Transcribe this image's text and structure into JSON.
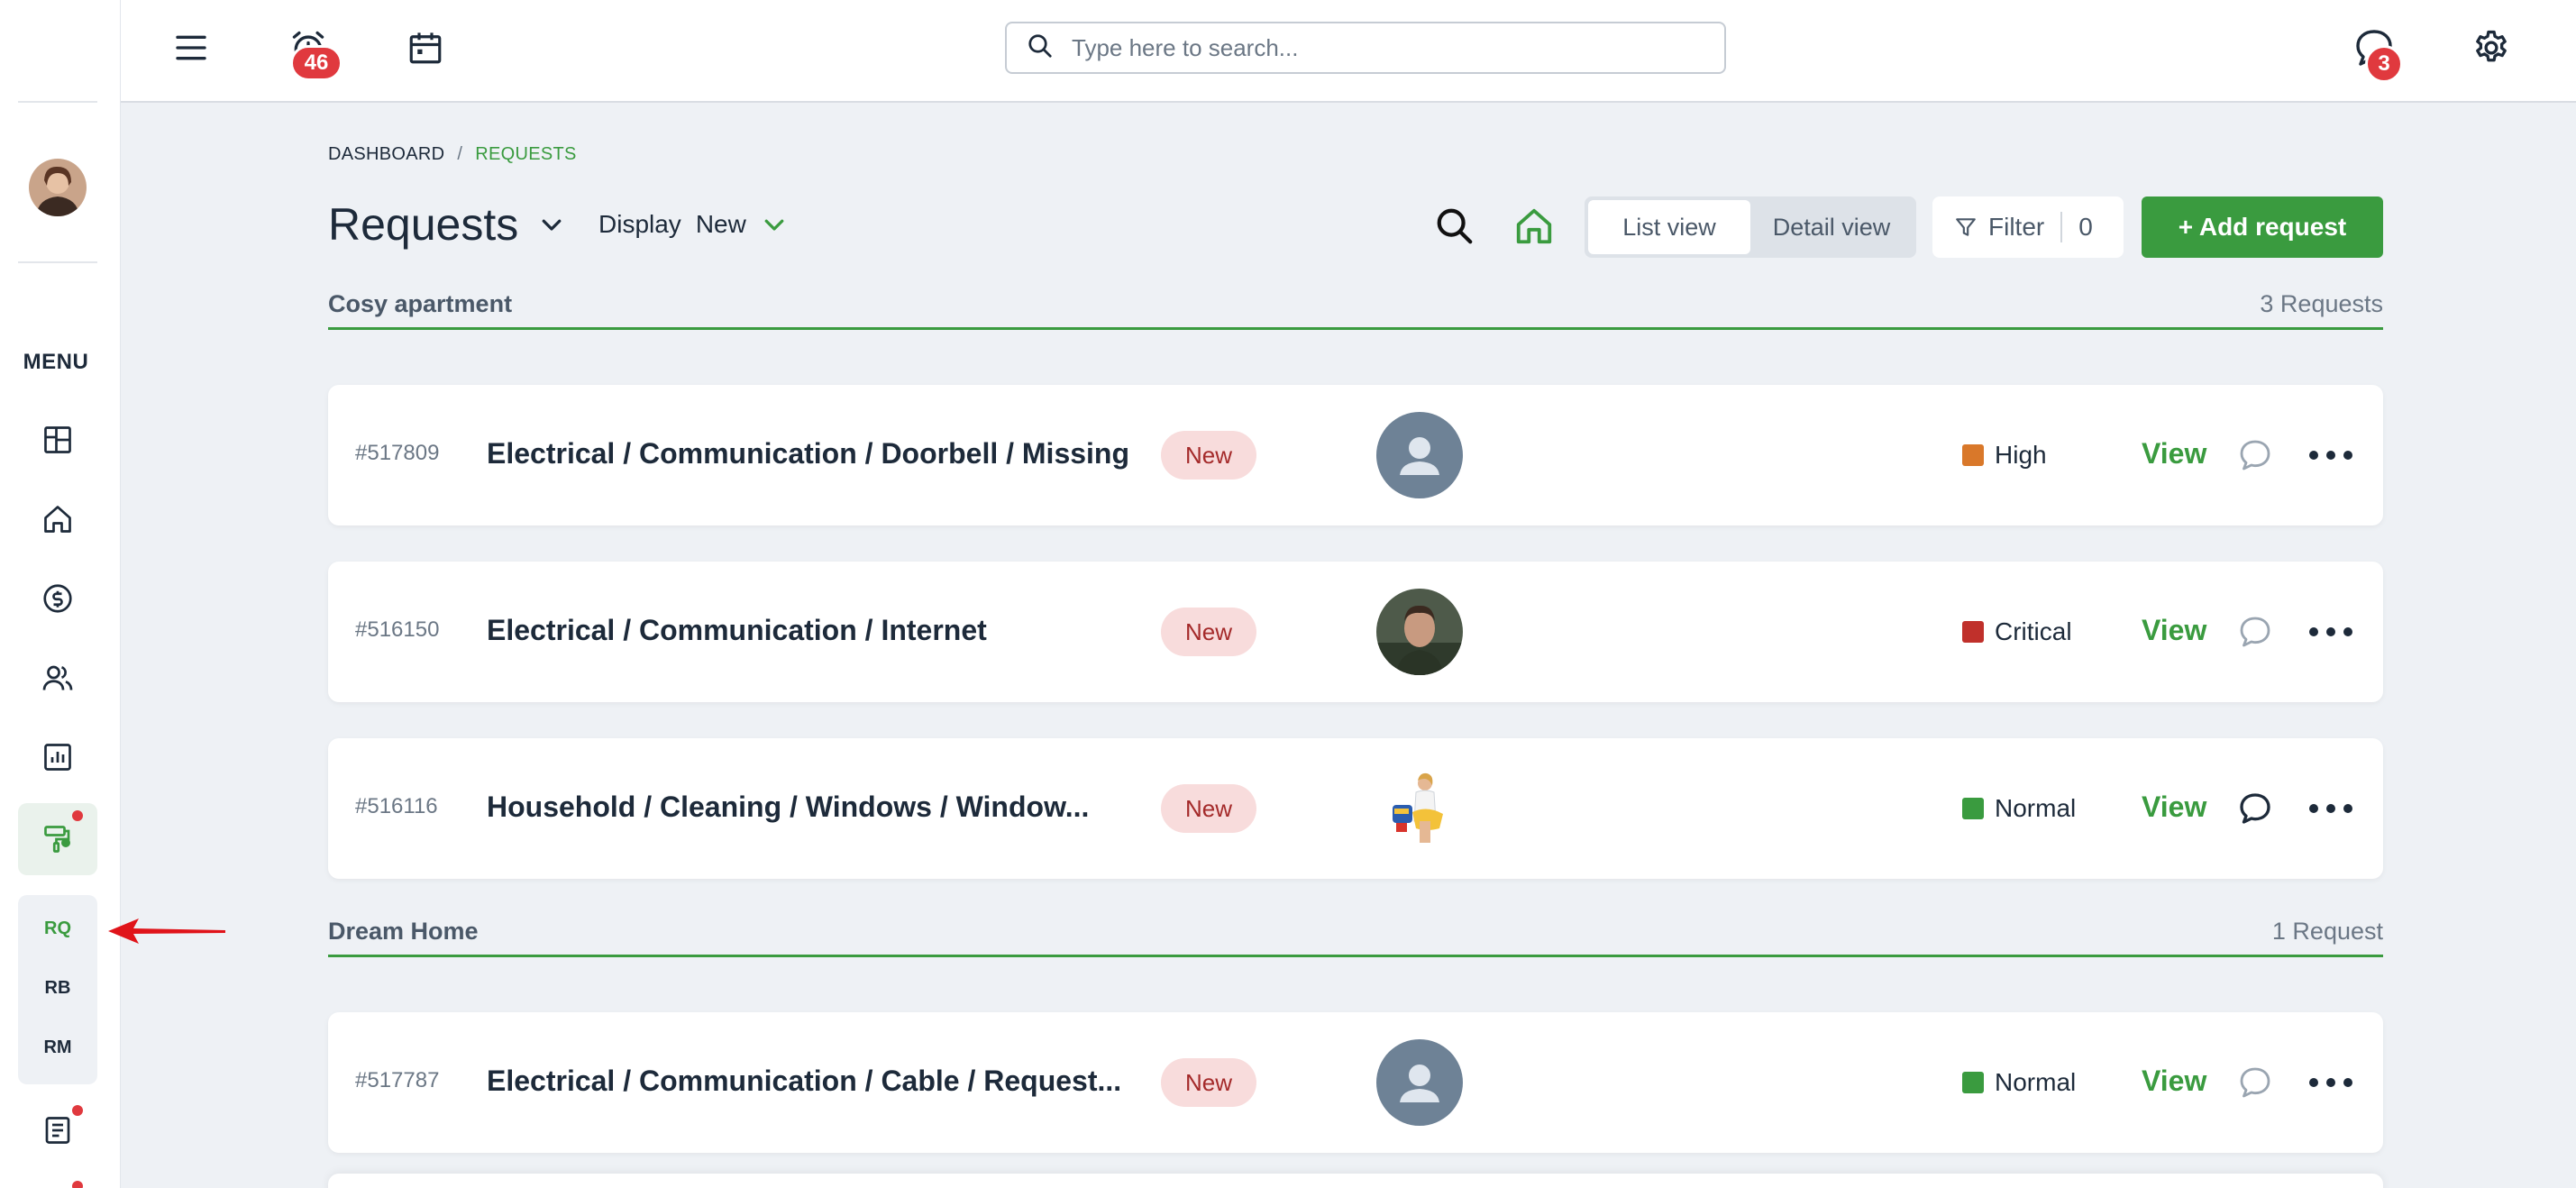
{
  "topbar": {
    "notifications_count": "46",
    "messages_count": "3",
    "search_placeholder": "Type here to search..."
  },
  "sidebar": {
    "menu_label": "MENU",
    "sub_items": [
      "RQ",
      "RB",
      "RM"
    ],
    "active_sub_item": "RQ"
  },
  "breadcrumb": {
    "items": [
      "DASHBOARD",
      "REQUESTS"
    ],
    "separator": "/"
  },
  "page": {
    "title": "Requests",
    "display_label": "Display",
    "display_value": "New",
    "view_options": [
      "List view",
      "Detail view"
    ],
    "active_view": "List view",
    "filter_label": "Filter",
    "filter_count": "0",
    "add_button_label": "+ Add request"
  },
  "groups": [
    {
      "name": "Cosy apartment",
      "count_label": "3 Requests",
      "requests": [
        {
          "id": "#517809",
          "title": "Electrical / Communication / Doorbell / Missing",
          "status": "New",
          "assignee": "placeholder-avatar",
          "priority": "High",
          "priority_color": "#d9782a",
          "action": "View",
          "has_comments": false
        },
        {
          "id": "#516150",
          "title": "Electrical / Communication / Internet",
          "status": "New",
          "assignee": "photo-man",
          "priority": "Critical",
          "priority_color": "#c0302b",
          "action": "View",
          "has_comments": false
        },
        {
          "id": "#516116",
          "title": "Household / Cleaning / Windows / Window...",
          "status": "New",
          "assignee": "photo-cleaner",
          "priority": "Normal",
          "priority_color": "#3a9b3f",
          "action": "View",
          "has_comments": true
        }
      ]
    },
    {
      "name": "Dream Home",
      "count_label": "1 Request",
      "requests": [
        {
          "id": "#517787",
          "title": "Electrical / Communication / Cable / Request...",
          "status": "New",
          "assignee": "placeholder-avatar",
          "priority": "Normal",
          "priority_color": "#3a9b3f",
          "action": "View",
          "has_comments": false
        }
      ]
    }
  ],
  "colors": {
    "accent": "#3a9b3f",
    "badge": "#e0393e",
    "status_bg": "#f8dcdc",
    "background": "#eef1f5"
  }
}
